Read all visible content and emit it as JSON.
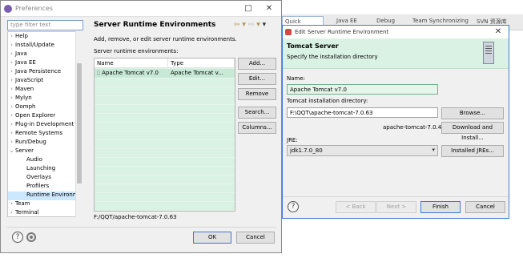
{
  "eclipse": {
    "quick_access": "Quick Access",
    "toolbar_items": [
      "Java EE",
      "Debug",
      "Team Synchronizing",
      "SVN 资源库"
    ]
  },
  "prefs": {
    "title": "Preferences",
    "filter_placeholder": "type filter text",
    "tree": [
      {
        "label": "Help",
        "chevron": ">",
        "indent": 0
      },
      {
        "label": "Install/Update",
        "chevron": ">",
        "indent": 0
      },
      {
        "label": "Java",
        "chevron": ">",
        "indent": 0
      },
      {
        "label": "Java EE",
        "chevron": ">",
        "indent": 0
      },
      {
        "label": "Java Persistence",
        "chevron": ">",
        "indent": 0
      },
      {
        "label": "JavaScript",
        "chevron": ">",
        "indent": 0
      },
      {
        "label": "Maven",
        "chevron": ">",
        "indent": 0
      },
      {
        "label": "Mylyn",
        "chevron": ">",
        "indent": 0
      },
      {
        "label": "Oomph",
        "chevron": ">",
        "indent": 0
      },
      {
        "label": "Open Explorer",
        "chevron": ">",
        "indent": 0
      },
      {
        "label": "Plug-in Development",
        "chevron": ">",
        "indent": 0
      },
      {
        "label": "Remote Systems",
        "chevron": ">",
        "indent": 0
      },
      {
        "label": "Run/Debug",
        "chevron": ">",
        "indent": 0
      },
      {
        "label": "Server",
        "chevron": "v",
        "indent": 0
      },
      {
        "label": "Audio",
        "chevron": "",
        "indent": 1
      },
      {
        "label": "Launching",
        "chevron": "",
        "indent": 1
      },
      {
        "label": "Overlays",
        "chevron": "",
        "indent": 1
      },
      {
        "label": "Profilers",
        "chevron": "",
        "indent": 1
      },
      {
        "label": "Runtime Environm",
        "chevron": "",
        "indent": 1,
        "selected": true
      },
      {
        "label": "Team",
        "chevron": ">",
        "indent": 0
      },
      {
        "label": "Terminal",
        "chevron": ">",
        "indent": 0
      }
    ],
    "page_title": "Server Runtime Environments",
    "description": "Add, remove, or edit server runtime environments.",
    "list_label": "Server runtime environments:",
    "table": {
      "columns": [
        "Name",
        "Type"
      ],
      "rows": [
        [
          "Apache Tomcat v7.0",
          "Apache Tomcat v..."
        ]
      ]
    },
    "buttons": {
      "add": "Add...",
      "edit": "Edit...",
      "remove": "Remove",
      "search": "Search...",
      "columns": "Columns..."
    },
    "path": "F:/QQT/apache-tomcat-7.0.63",
    "ok": "OK",
    "cancel": "Cancel"
  },
  "edit": {
    "title": "Edit Server Runtime Environment",
    "banner_title": "Tomcat Server",
    "banner_sub": "Specify the installation directory",
    "name_label": "Name:",
    "name_value": "Apache Tomcat v7.0",
    "dir_label": "Tomcat installation directory:",
    "dir_value": "F:\\QQT\\apache-tomcat-7.0.63",
    "browse": "Browse...",
    "version_hint": "apache-tomcat-7.0.47",
    "download": "Download and Install...",
    "jre_label": "JRE:",
    "jre_value": "jdk1.7.0_80",
    "installed_jres": "Installed JREs...",
    "back": "< Back",
    "next": "Next >",
    "finish": "Finish",
    "cancel": "Cancel"
  }
}
